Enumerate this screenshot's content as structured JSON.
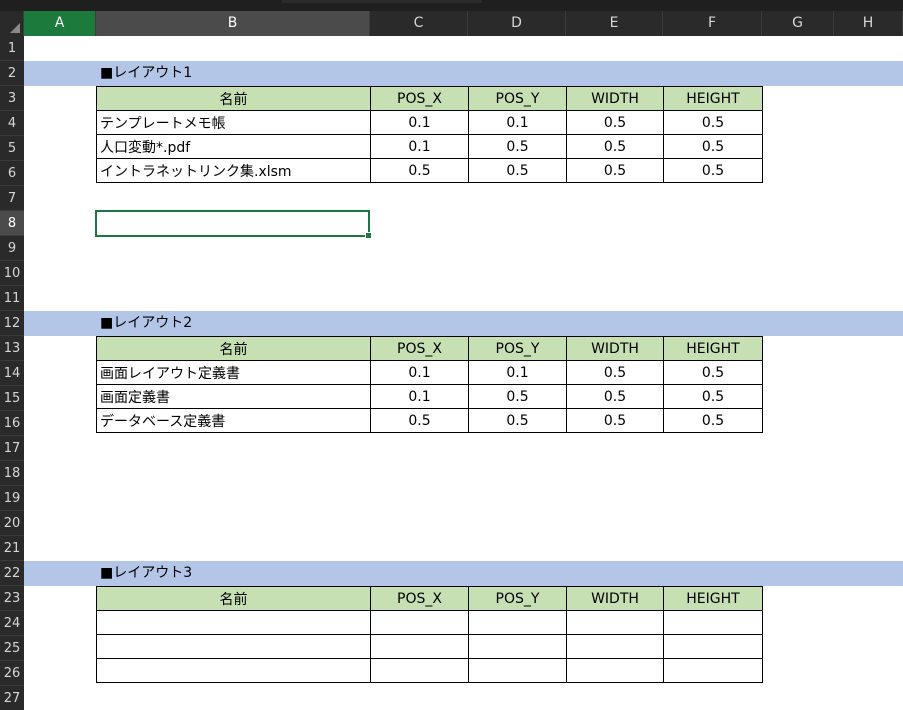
{
  "columns": [
    "A",
    "B",
    "C",
    "D",
    "E",
    "F",
    "G",
    "H"
  ],
  "rows": [
    "1",
    "2",
    "3",
    "4",
    "5",
    "6",
    "7",
    "8",
    "9",
    "10",
    "11",
    "12",
    "13",
    "14",
    "15",
    "16",
    "17",
    "18",
    "19",
    "20",
    "21",
    "22",
    "23",
    "24",
    "25",
    "26",
    "27"
  ],
  "active_cell": "B8",
  "colors": {
    "section_band": "#b4c6e7",
    "header_fill": "#c6e0b4",
    "selection_border": "#217346"
  },
  "layouts": [
    {
      "title": "■レイアウト1",
      "headers": [
        "名前",
        "POS_X",
        "POS_Y",
        "WIDTH",
        "HEIGHT"
      ],
      "rows": [
        [
          "テンプレートメモ帳",
          "0.1",
          "0.1",
          "0.5",
          "0.5"
        ],
        [
          "人口変動*.pdf",
          "0.1",
          "0.5",
          "0.5",
          "0.5"
        ],
        [
          "イントラネットリンク集.xlsm",
          "0.5",
          "0.5",
          "0.5",
          "0.5"
        ]
      ]
    },
    {
      "title": "■レイアウト2",
      "headers": [
        "名前",
        "POS_X",
        "POS_Y",
        "WIDTH",
        "HEIGHT"
      ],
      "rows": [
        [
          "画面レイアウト定義書",
          "0.1",
          "0.1",
          "0.5",
          "0.5"
        ],
        [
          "画面定義書",
          "0.1",
          "0.5",
          "0.5",
          "0.5"
        ],
        [
          "データベース定義書",
          "0.5",
          "0.5",
          "0.5",
          "0.5"
        ]
      ]
    },
    {
      "title": "■レイアウト3",
      "headers": [
        "名前",
        "POS_X",
        "POS_Y",
        "WIDTH",
        "HEIGHT"
      ],
      "rows": [
        [
          "",
          "",
          "",
          "",
          ""
        ],
        [
          "",
          "",
          "",
          "",
          ""
        ],
        [
          "",
          "",
          "",
          "",
          ""
        ]
      ]
    }
  ]
}
